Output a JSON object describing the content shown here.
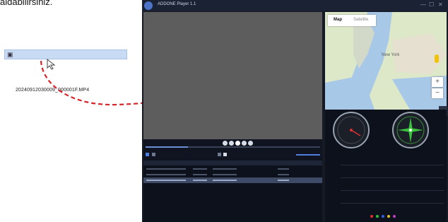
{
  "intro": {
    "partial_text": "aidabilirsiniz."
  },
  "file": {
    "icon": "video-file-icon",
    "name": "20240912030009_000001F.MP4"
  },
  "player": {
    "title": "ADDONE Player 1.1",
    "controls": [
      "minimize-icon",
      "maximize-icon",
      "close-icon"
    ]
  },
  "map": {
    "tabs": [
      "Map",
      "Satellite"
    ],
    "labels": {
      "city": "New York"
    },
    "zoom": [
      "+",
      "−"
    ]
  },
  "table": {
    "rows": [
      {
        "selected": false
      },
      {
        "selected": false
      },
      {
        "selected": true
      }
    ]
  },
  "colors": {
    "arrow": "#d8242a",
    "file_bar": "#c9daf3",
    "video_bg": "#5d5d5d",
    "app_bg": "#151a24",
    "legend": [
      "#e03030",
      "#30c040",
      "#3060e0",
      "#e0c030",
      "#c040c0"
    ]
  }
}
